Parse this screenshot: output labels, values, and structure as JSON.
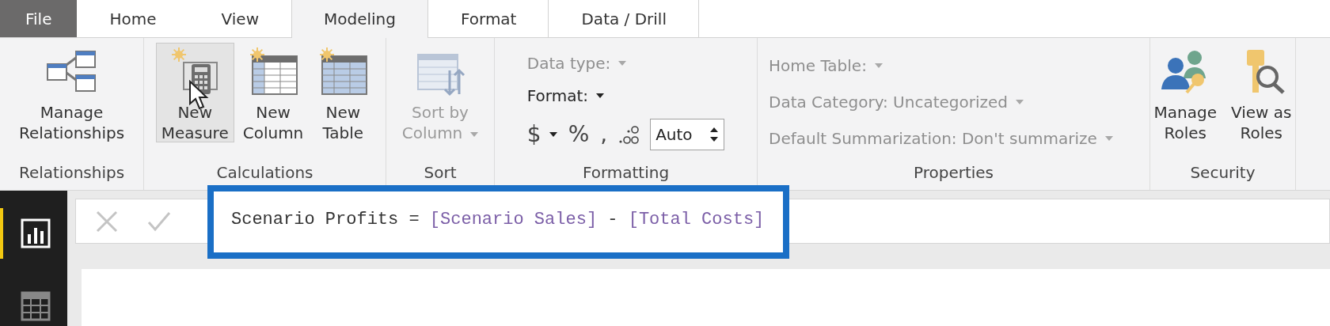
{
  "tabs": [
    {
      "label": "File",
      "kind": "file",
      "selected": false
    },
    {
      "label": "Home",
      "kind": "plain",
      "selected": false
    },
    {
      "label": "View",
      "kind": "plain",
      "selected": false
    },
    {
      "label": "Modeling",
      "kind": "plain",
      "selected": true
    },
    {
      "label": "Format",
      "kind": "context",
      "selected": false
    },
    {
      "label": "Data / Drill",
      "kind": "context",
      "selected": false
    }
  ],
  "ribbon": [
    {
      "kind": "buttons",
      "label": "Relationships",
      "buttons": [
        {
          "lines": [
            "Manage",
            "Relationships"
          ],
          "hovered": false,
          "disabled": false
        }
      ]
    },
    {
      "kind": "buttons",
      "label": "Calculations",
      "buttons": [
        {
          "lines": [
            "New",
            "Measure"
          ],
          "hovered": true,
          "disabled": false
        },
        {
          "lines": [
            "New",
            "Column"
          ],
          "hovered": false,
          "disabled": false
        },
        {
          "lines": [
            "New",
            "Table"
          ],
          "hovered": false,
          "disabled": false
        }
      ]
    },
    {
      "kind": "buttons",
      "label": "Sort",
      "buttons": [
        {
          "lines": [
            "Sort by",
            "Column"
          ],
          "hovered": false,
          "disabled": true,
          "dropdown": true
        }
      ]
    },
    {
      "kind": "formatting",
      "label": "Formatting",
      "data_type": {
        "label": "Data type:",
        "disabled": true
      },
      "format": {
        "label": "Format:",
        "disabled": false
      },
      "currency": "$",
      "percent": "%",
      "comma": ",",
      "decimals": {
        "value": "Auto"
      }
    },
    {
      "kind": "properties",
      "label": "Properties",
      "fields": [
        {
          "label": "Home Table:",
          "disabled": true
        },
        {
          "label": "Data Category: Uncategorized",
          "disabled": true
        },
        {
          "label": "Default Summarization: Don't summarize",
          "disabled": true
        }
      ]
    },
    {
      "kind": "buttons",
      "label": "Security",
      "buttons": [
        {
          "lines": [
            "Manage",
            "Roles"
          ],
          "hovered": false,
          "disabled": false
        },
        {
          "lines": [
            "View as",
            "Roles"
          ],
          "hovered": false,
          "disabled": false
        }
      ]
    }
  ],
  "sidebar": [
    {
      "selected": true
    },
    {
      "selected": false
    }
  ],
  "formula": {
    "highlighted": true,
    "tokens": [
      {
        "kind": "text",
        "text": "Scenario Profits = "
      },
      {
        "kind": "measure",
        "text": "[Scenario Sales]"
      },
      {
        "kind": "text",
        "text": " - "
      },
      {
        "kind": "measure",
        "text": "[Total Costs]"
      }
    ]
  }
}
